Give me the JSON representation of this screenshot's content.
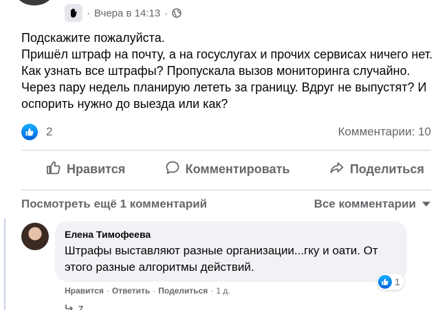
{
  "post": {
    "timestamp": "Вчера в 14:13",
    "separator": "·",
    "text_lines": [
      "Подскажите пожалуйста.",
      "Пришёл штраф на почту, а на госуслугах и прочих сервисах ничего нет. Как узнать все штрафы? Пропускала вызов мониторинга случайно. Через пару недель планирую лететь за границу. Вдруг не выпустят? И оспорить нужно до выезда или как?"
    ],
    "reaction_count": "2",
    "comments_count": "Комментарии: 10"
  },
  "actions": {
    "like": "Нравится",
    "comment": "Комментировать",
    "share": "Поделиться"
  },
  "comments_section": {
    "view_more": "Посмотреть ещё 1 комментарий",
    "sort_label": "Все комментарии"
  },
  "comment": {
    "author": "Елена Тимофеева",
    "text": "Штрафы выставляют разные организации...гку и оати. От этого разные алгоритмы действий.",
    "reaction_count": "1",
    "like_action": "Нравится",
    "reply_action": "Ответить",
    "share_action": "Поделиться",
    "dot": "·",
    "age": "1 д."
  },
  "reply_hint": {
    "count": "7"
  },
  "colors": {
    "secondary_text": "#65676b",
    "primary_text": "#050505",
    "bubble_bg": "#f0f2f5",
    "like_blue": "#1877f2",
    "divider": "#ced0d4"
  }
}
